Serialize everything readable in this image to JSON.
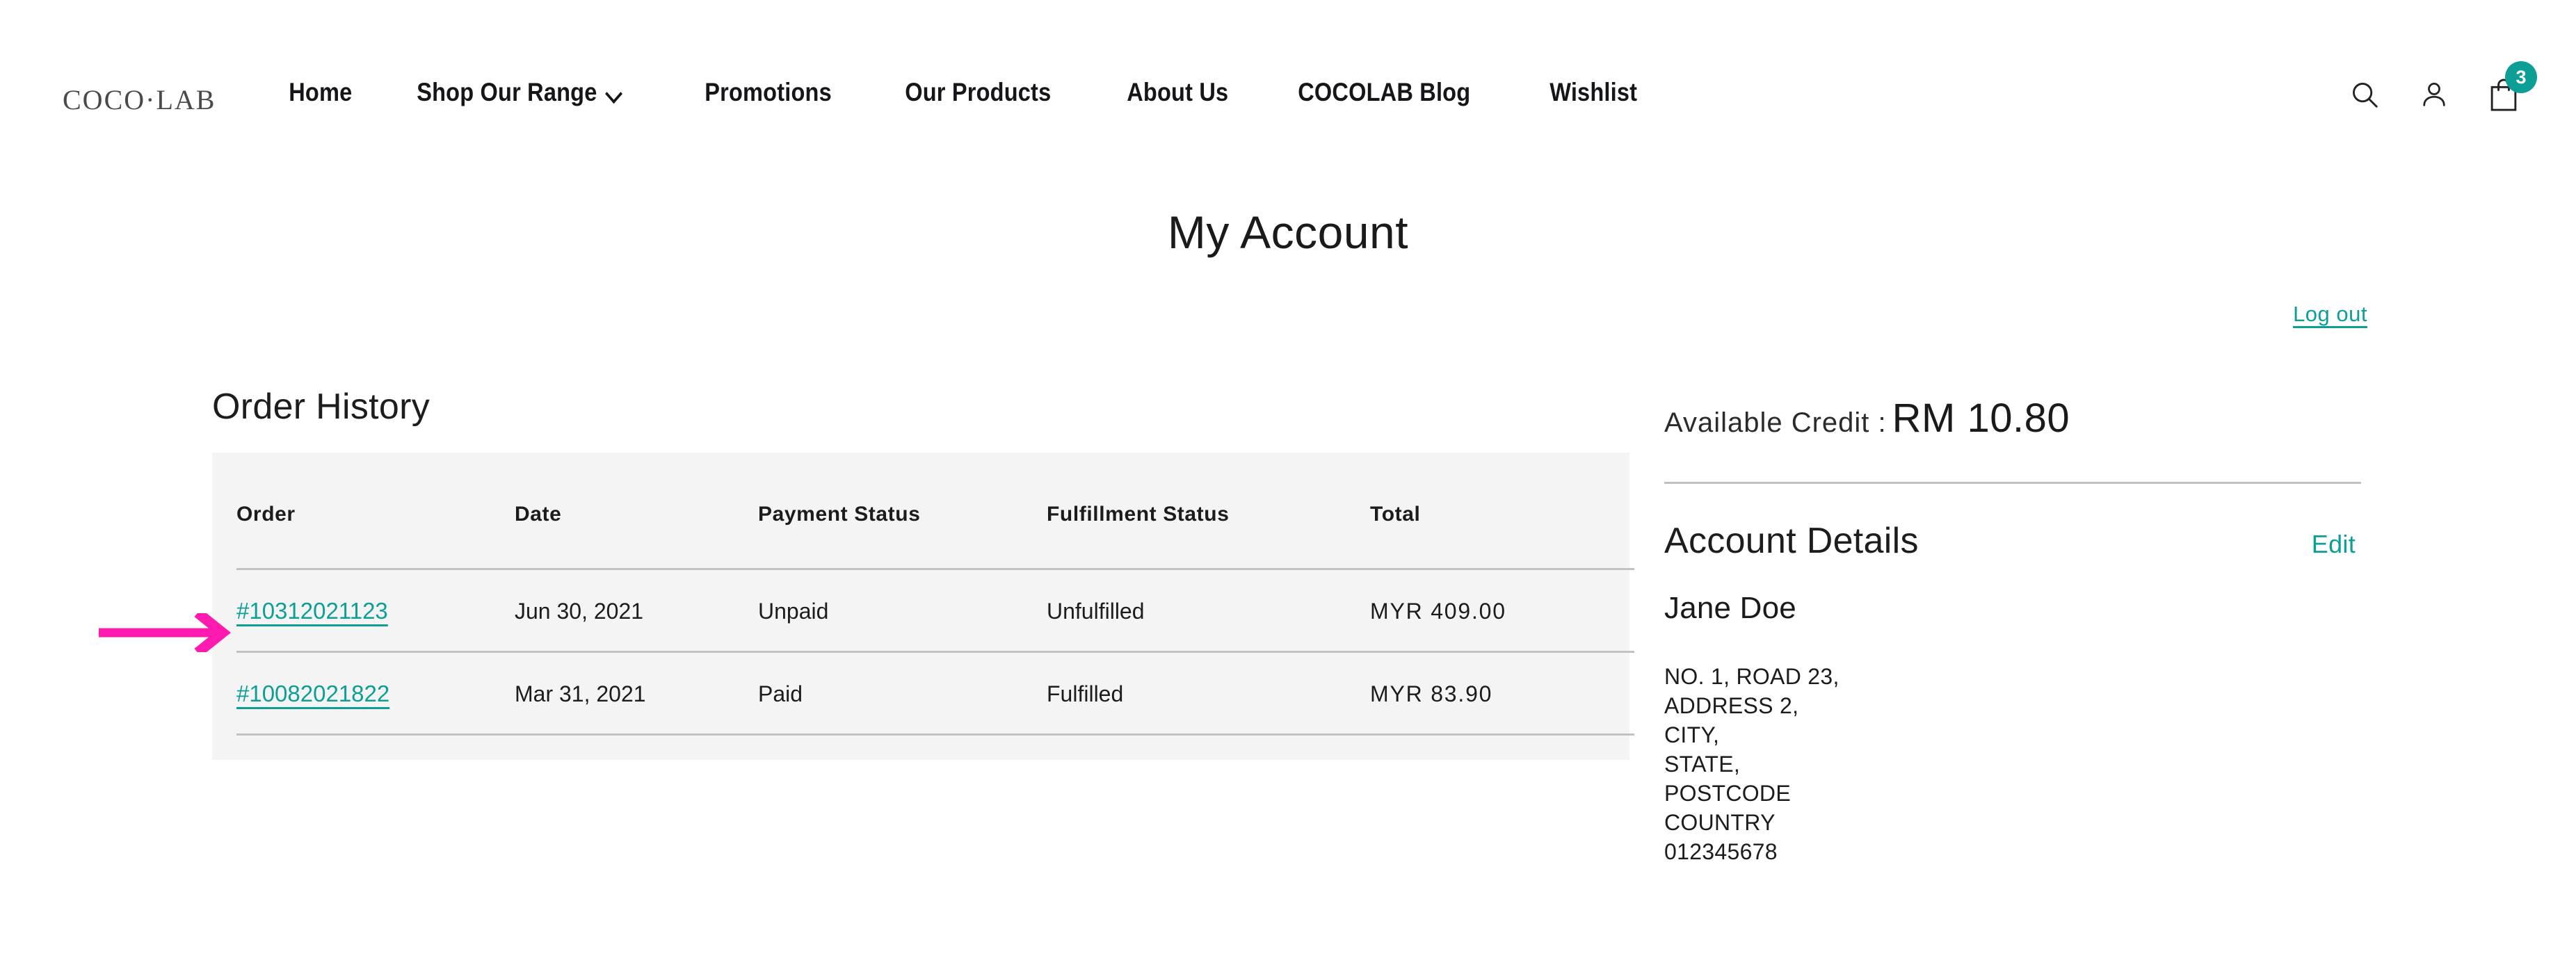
{
  "header": {
    "logo": "COCO·LAB",
    "nav": [
      {
        "label": "Home",
        "has_chevron": false
      },
      {
        "label": "Shop Our Range",
        "has_chevron": true,
        "chevron_icon": "chevron-down-icon"
      },
      {
        "label": "Promotions",
        "has_chevron": false
      },
      {
        "label": "Our Products",
        "has_chevron": false
      },
      {
        "label": "About Us",
        "has_chevron": false
      },
      {
        "label": "COCOLAB Blog",
        "has_chevron": false
      },
      {
        "label": "Wishlist",
        "has_chevron": false
      }
    ],
    "icons": {
      "search": "search-icon",
      "account": "user-icon",
      "cart": "shopping-bag-icon"
    },
    "cart_count": "3",
    "cart_badge_color": "#0d9e96"
  },
  "page": {
    "title": "My Account",
    "logout_label": "Log out",
    "link_color": "#0d9e96"
  },
  "order_history": {
    "title": "Order History",
    "columns": [
      "Order",
      "Date",
      "Payment Status",
      "Fulfillment Status",
      "Total"
    ],
    "rows": [
      {
        "order": "#10312021123",
        "date": "Jun 30, 2021",
        "payment_status": "Unpaid",
        "fulfillment_status": "Unfulfilled",
        "total": "MYR 409.00"
      },
      {
        "order": "#10082021822",
        "date": "Mar 31, 2021",
        "payment_status": "Paid",
        "fulfillment_status": "Fulfilled",
        "total": "MYR 83.90"
      }
    ],
    "panel_background": "#f4f4f4"
  },
  "annotation": {
    "arrow_color": "#ff1ab0",
    "points_to": "#10312021123"
  },
  "account": {
    "credit_label": "Available Credit :",
    "credit_value": "RM 10.80",
    "details_title": "Account Details",
    "edit_label": "Edit",
    "customer_name": "Jane Doe",
    "address_lines": [
      "NO. 1, ROAD 23,",
      "ADDRESS 2,",
      "CITY,",
      "STATE,",
      "POSTCODE",
      "COUNTRY",
      "012345678"
    ]
  }
}
